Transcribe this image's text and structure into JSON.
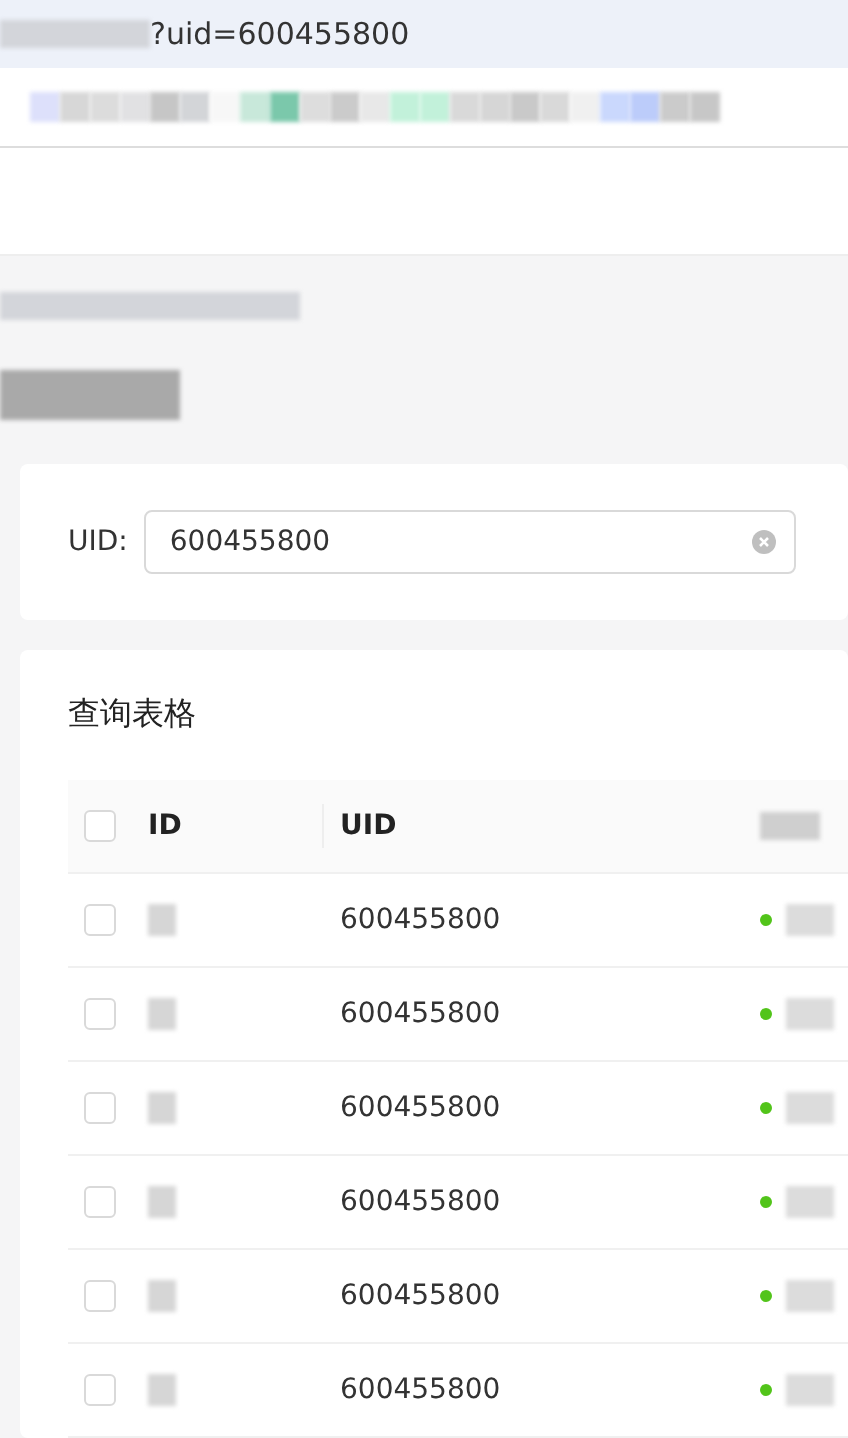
{
  "address_bar": {
    "url": "?uid=600455800"
  },
  "search_form": {
    "label": "UID:",
    "field": {
      "value": "600455800"
    }
  },
  "table": {
    "title": "查询表格",
    "select_all": {
      "checked": false
    },
    "columns": [
      "ID",
      "UID"
    ],
    "rows": [
      {
        "checked": false,
        "uid": "600455800",
        "color": "#52c41a"
      },
      {
        "checked": false,
        "uid": "600455800",
        "color": "#52c41a"
      },
      {
        "checked": false,
        "uid": "600455800",
        "color": "#52c41a"
      },
      {
        "checked": false,
        "uid": "600455800",
        "color": "#52c41a"
      },
      {
        "checked": false,
        "uid": "600455800",
        "color": "#52c41a"
      },
      {
        "checked": false,
        "uid": "600455800",
        "color": "#52c41a"
      }
    ]
  }
}
